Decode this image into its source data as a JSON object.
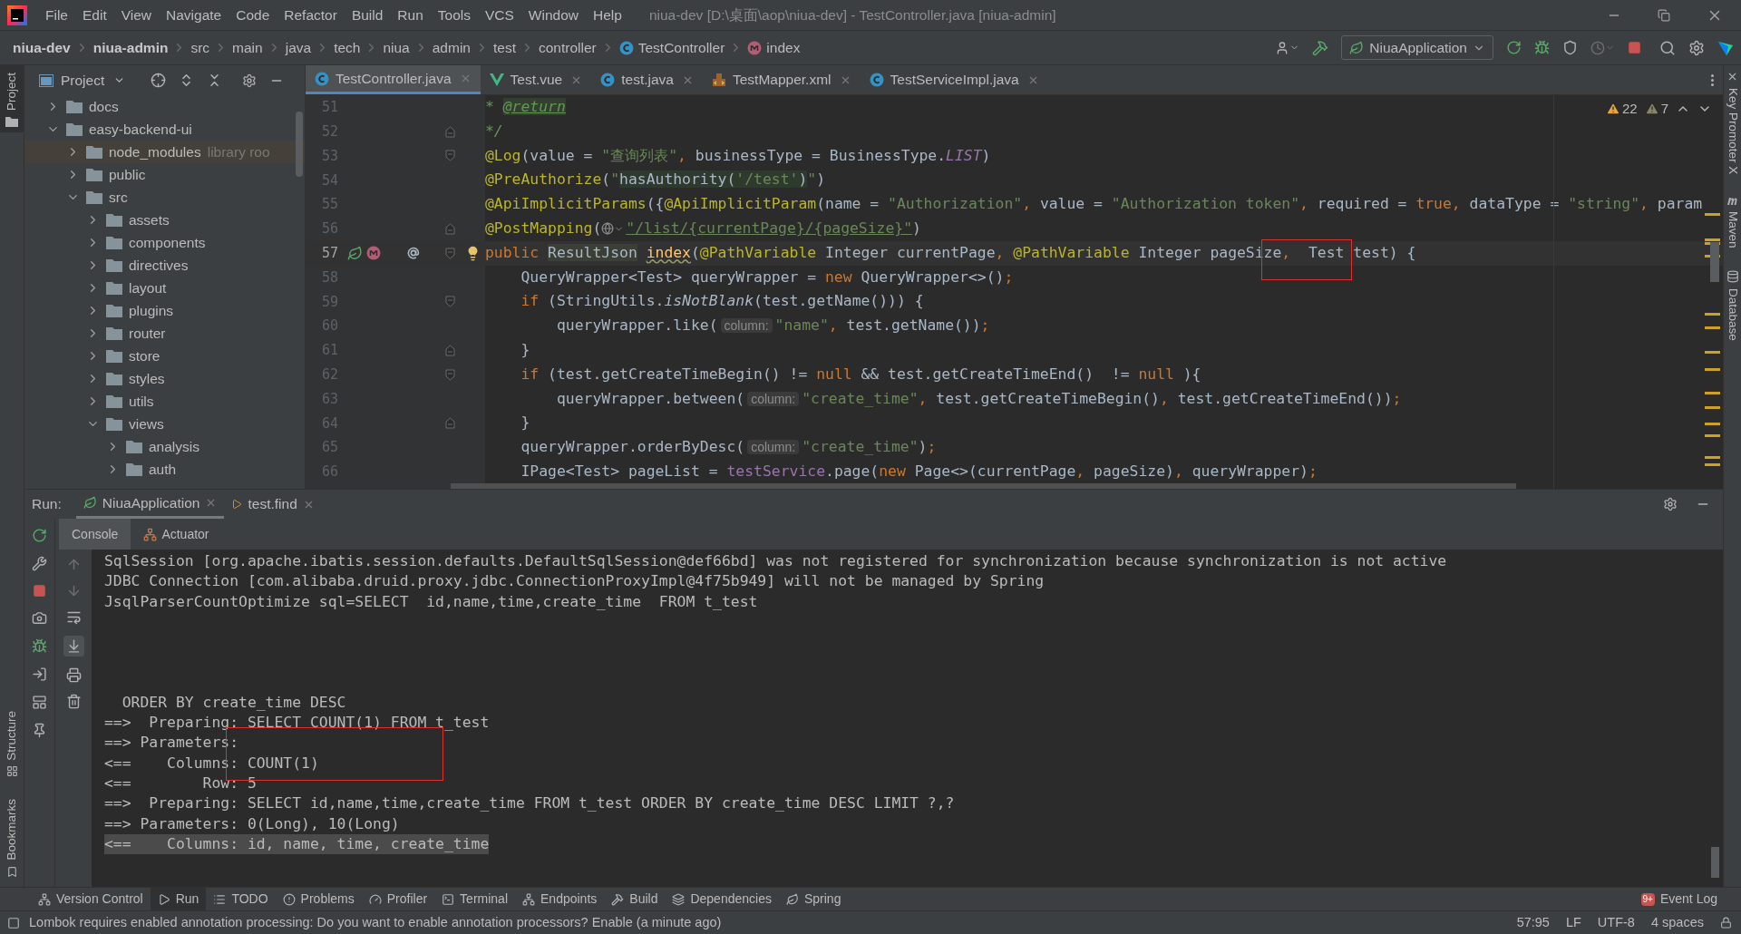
{
  "menu": [
    "File",
    "Edit",
    "View",
    "Navigate",
    "Code",
    "Refactor",
    "Build",
    "Run",
    "Tools",
    "VCS",
    "Window",
    "Help"
  ],
  "window": {
    "title": "niua-dev [D:\\桌面\\aop\\niua-dev] - TestController.java [niua-admin]"
  },
  "breadcrumb": [
    {
      "kind": "module",
      "label": "niua-dev"
    },
    {
      "kind": "module",
      "label": "niua-admin"
    },
    {
      "kind": "folder",
      "label": "src"
    },
    {
      "kind": "folder",
      "label": "main"
    },
    {
      "kind": "folder",
      "label": "java"
    },
    {
      "kind": "folder",
      "label": "tech"
    },
    {
      "kind": "folder",
      "label": "niua"
    },
    {
      "kind": "folder",
      "label": "admin"
    },
    {
      "kind": "folder",
      "label": "test"
    },
    {
      "kind": "folder",
      "label": "controller"
    },
    {
      "kind": "class",
      "label": "TestController"
    },
    {
      "kind": "method",
      "label": "index"
    }
  ],
  "run_config": {
    "label": "NiuaApplication"
  },
  "project_panel": {
    "title": "Project",
    "tree": [
      {
        "name": "docs",
        "expanded": false
      },
      {
        "name": "easy-backend-ui",
        "expanded": true,
        "children": [
          {
            "name": "node_modules",
            "note": "library roo",
            "expanded": false
          },
          {
            "name": "public",
            "expanded": false
          },
          {
            "name": "src",
            "expanded": true,
            "children": [
              {
                "name": "assets",
                "expanded": false
              },
              {
                "name": "components",
                "expanded": false
              },
              {
                "name": "directives",
                "expanded": false
              },
              {
                "name": "layout",
                "expanded": false
              },
              {
                "name": "plugins",
                "expanded": false
              },
              {
                "name": "router",
                "expanded": false
              },
              {
                "name": "store",
                "expanded": false
              },
              {
                "name": "styles",
                "expanded": false
              },
              {
                "name": "utils",
                "expanded": false
              },
              {
                "name": "views",
                "expanded": true,
                "children": [
                  {
                    "name": "analysis",
                    "expanded": false
                  },
                  {
                    "name": "auth",
                    "expanded": false
                  }
                ]
              }
            ]
          }
        ]
      }
    ]
  },
  "editor_tabs": [
    {
      "kind": "class",
      "label": "TestController.java",
      "selected": true
    },
    {
      "kind": "vue",
      "label": "Test.vue",
      "selected": false
    },
    {
      "kind": "class",
      "label": "test.java",
      "selected": false
    },
    {
      "kind": "xml",
      "label": "TestMapper.xml",
      "selected": false
    },
    {
      "kind": "class",
      "label": "TestServiceImpl.java",
      "selected": false
    }
  ],
  "inspections": {
    "warnings": "22",
    "weak_warnings": "7"
  },
  "code_lines": [
    {
      "num": "51",
      "current": false,
      "fold_start": false,
      "fold_end": false,
      "tokens": [
        {
          "kind": "doc",
          "text": "* "
        },
        {
          "kind": "doctag",
          "text": "@return"
        }
      ]
    },
    {
      "num": "52",
      "current": false,
      "fold_start": false,
      "fold_end": true,
      "tokens": [
        {
          "kind": "doc",
          "text": "*/"
        }
      ]
    },
    {
      "num": "53",
      "current": false,
      "fold_start": true,
      "fold_end": false,
      "tokens": [
        {
          "kind": "ann",
          "text": "@Log"
        },
        {
          "kind": "plain",
          "text": "(value = "
        },
        {
          "kind": "str",
          "text": "\"查询列表\""
        },
        {
          "kind": "kw",
          "text": ", "
        },
        {
          "kind": "plain",
          "text": "businessType = BusinessType."
        },
        {
          "kind": "static",
          "text": "LIST"
        },
        {
          "kind": "plain",
          "text": ")"
        }
      ]
    },
    {
      "num": "54",
      "current": false,
      "fold_start": false,
      "fold_end": false,
      "tokens": [
        {
          "kind": "ann",
          "text": "@PreAuthorize"
        },
        {
          "kind": "plain",
          "text": "("
        },
        {
          "kind": "str",
          "text": "\""
        },
        {
          "kind": "inject",
          "text": "hasAuthority("
        },
        {
          "kind": "injectstr",
          "text": "'/test'"
        },
        {
          "kind": "inject",
          "text": ")"
        },
        {
          "kind": "str",
          "text": "\""
        },
        {
          "kind": "plain",
          "text": ")"
        }
      ]
    },
    {
      "num": "55",
      "current": false,
      "fold_start": false,
      "fold_end": false,
      "tokens": [
        {
          "kind": "ann",
          "text": "@ApiImplicitParams"
        },
        {
          "kind": "plain",
          "text": "({"
        },
        {
          "kind": "ann",
          "text": "@ApiImplicitParam"
        },
        {
          "kind": "plain",
          "text": "(name = "
        },
        {
          "kind": "str",
          "text": "\"Authorization\""
        },
        {
          "kind": "kw",
          "text": ", "
        },
        {
          "kind": "plain",
          "text": "value = "
        },
        {
          "kind": "str",
          "text": "\"Authorization token\""
        },
        {
          "kind": "kw",
          "text": ", "
        },
        {
          "kind": "plain",
          "text": "required = "
        },
        {
          "kind": "kw",
          "text": "true, "
        },
        {
          "kind": "plain",
          "text": "dataType = "
        },
        {
          "kind": "str",
          "text": "\"string\""
        },
        {
          "kind": "kw",
          "text": ", "
        },
        {
          "kind": "plain",
          "text": "param"
        }
      ]
    },
    {
      "num": "56",
      "current": false,
      "fold_start": false,
      "fold_end": true,
      "tokens": [
        {
          "kind": "ann",
          "text": "@PostMapping"
        },
        {
          "kind": "plain",
          "text": "("
        },
        {
          "kind": "url",
          "text": "\"/list/{currentPage}/{pageSize}\""
        },
        {
          "kind": "plain",
          "text": ")"
        }
      ]
    },
    {
      "num": "57",
      "current": true,
      "fold_start": true,
      "fold_end": false,
      "tokens": [
        {
          "kind": "kw",
          "text": "public "
        },
        {
          "kind": "typebg",
          "text": "ResultJson"
        },
        {
          "kind": "decl",
          "text": " index"
        },
        {
          "kind": "plain",
          "text": "("
        },
        {
          "kind": "ann",
          "text": "@PathVariable"
        },
        {
          "kind": "plain",
          "text": " Integer currentPage"
        },
        {
          "kind": "kw",
          "text": ", "
        },
        {
          "kind": "ann",
          "text": "@PathVariable"
        },
        {
          "kind": "plain",
          "text": " Integer pageSize"
        },
        {
          "kind": "kw",
          "text": ", "
        },
        {
          "kind": "plain",
          "text": " Test test) {"
        }
      ]
    },
    {
      "num": "58",
      "current": false,
      "fold_start": false,
      "fold_end": false,
      "tokens": [
        {
          "kind": "plain",
          "text": "    QueryWrapper<Test> queryWrapper = "
        },
        {
          "kind": "kw",
          "text": "new "
        },
        {
          "kind": "plain",
          "text": "QueryWrapper<>()"
        },
        {
          "kind": "kw",
          "text": ";"
        }
      ]
    },
    {
      "num": "59",
      "current": false,
      "fold_start": true,
      "fold_end": false,
      "tokens": [
        {
          "kind": "kw",
          "text": "    if "
        },
        {
          "kind": "plain",
          "text": "(StringUtils."
        },
        {
          "kind": "italic",
          "text": "isNotBlank"
        },
        {
          "kind": "plain",
          "text": "(test.getName())) {"
        }
      ]
    },
    {
      "num": "60",
      "current": false,
      "fold_start": false,
      "fold_end": false,
      "tokens": [
        {
          "kind": "plain",
          "text": "        queryWrapper.like("
        },
        {
          "kind": "hint",
          "text": "column:"
        },
        {
          "kind": "str",
          "text": "\"name\""
        },
        {
          "kind": "kw",
          "text": ", "
        },
        {
          "kind": "plain",
          "text": "test.getName())"
        },
        {
          "kind": "kw",
          "text": ";"
        }
      ]
    },
    {
      "num": "61",
      "current": false,
      "fold_start": false,
      "fold_end": true,
      "tokens": [
        {
          "kind": "plain",
          "text": "    }"
        }
      ]
    },
    {
      "num": "62",
      "current": false,
      "fold_start": true,
      "fold_end": false,
      "tokens": [
        {
          "kind": "kw",
          "text": "    if "
        },
        {
          "kind": "plain",
          "text": "(test.getCreateTimeBegin() != "
        },
        {
          "kind": "kw",
          "text": "null "
        },
        {
          "kind": "plain",
          "text": "&& test.getCreateTimeEnd()  != "
        },
        {
          "kind": "kw",
          "text": "null "
        },
        {
          "kind": "plain",
          "text": "){"
        }
      ]
    },
    {
      "num": "63",
      "current": false,
      "fold_start": false,
      "fold_end": false,
      "tokens": [
        {
          "kind": "plain",
          "text": "        queryWrapper.between("
        },
        {
          "kind": "hint",
          "text": "column:"
        },
        {
          "kind": "str",
          "text": "\"create_time\""
        },
        {
          "kind": "kw",
          "text": ", "
        },
        {
          "kind": "plain",
          "text": "test.getCreateTimeBegin()"
        },
        {
          "kind": "kw",
          "text": ", "
        },
        {
          "kind": "plain",
          "text": "test.getCreateTimeEnd())"
        },
        {
          "kind": "kw",
          "text": ";"
        }
      ]
    },
    {
      "num": "64",
      "current": false,
      "fold_start": false,
      "fold_end": true,
      "tokens": [
        {
          "kind": "plain",
          "text": "    }"
        }
      ]
    },
    {
      "num": "65",
      "current": false,
      "fold_start": false,
      "fold_end": false,
      "tokens": [
        {
          "kind": "plain",
          "text": "    queryWrapper.orderByDesc("
        },
        {
          "kind": "hint",
          "text": "column:"
        },
        {
          "kind": "str",
          "text": "\"create_time\""
        },
        {
          "kind": "plain",
          "text": ")"
        },
        {
          "kind": "kw",
          "text": ";"
        }
      ]
    },
    {
      "num": "66",
      "current": false,
      "fold_start": false,
      "fold_end": false,
      "tokens": [
        {
          "kind": "plain",
          "text": "    IPage<Test> pageList = "
        },
        {
          "kind": "field",
          "text": "testService"
        },
        {
          "kind": "plain",
          "text": ".page("
        },
        {
          "kind": "kw",
          "text": "new "
        },
        {
          "kind": "plain",
          "text": "Page<>(currentPage"
        },
        {
          "kind": "kw",
          "text": ", "
        },
        {
          "kind": "plain",
          "text": "pageSize)"
        },
        {
          "kind": "kw",
          "text": ", "
        },
        {
          "kind": "plain",
          "text": "queryWrapper)"
        },
        {
          "kind": "kw",
          "text": ";"
        }
      ]
    }
  ],
  "run_panel": {
    "label": "Run:",
    "tabs": [
      {
        "kind": "app",
        "label": "NiuaApplication",
        "selected": true
      },
      {
        "kind": "query",
        "label": "test.find",
        "selected": false
      }
    ],
    "subtabs": [
      {
        "kind": "console",
        "label": "Console",
        "selected": true
      },
      {
        "kind": "actuator",
        "label": "Actuator",
        "selected": false
      }
    ],
    "console_lines": [
      {
        "kind": "text",
        "text": "SqlSession [org.apache.ibatis.session.defaults.DefaultSqlSession@def66bd] was not registered for synchronization because synchronization is not active"
      },
      {
        "kind": "text",
        "text": "JDBC Connection [com.alibaba.druid.proxy.jdbc.ConnectionProxyImpl@4f75b949] will not be managed by Spring"
      },
      {
        "kind": "text",
        "text": "JsqlParserCountOptimize sql=SELECT  id,name,time,create_time  FROM t_test"
      },
      {
        "kind": "after_gap",
        "text": "  ORDER BY create_time DESC"
      },
      {
        "kind": "text",
        "text": "==>  Preparing: SELECT COUNT(1) FROM t_test"
      },
      {
        "kind": "text",
        "text": "==> Parameters: "
      },
      {
        "kind": "text",
        "text": "<==    Columns: COUNT(1)"
      },
      {
        "kind": "text",
        "text": "<==        Row: 5"
      },
      {
        "kind": "text",
        "text": "==>  Preparing: SELECT id,name,time,create_time FROM t_test ORDER BY create_time DESC LIMIT ?,?"
      },
      {
        "kind": "text",
        "text": "==> Parameters: 0(Long), 10(Long)"
      },
      {
        "kind": "selected",
        "text": "<==    Columns: id, name, time, create_time"
      }
    ]
  },
  "left_strip": [
    {
      "kind": "project",
      "label": "Project"
    },
    {
      "kind": "structure",
      "label": "Structure"
    },
    {
      "kind": "bookmarks",
      "label": "Bookmarks"
    }
  ],
  "right_strip": [
    {
      "kind": "promoter",
      "label": "Key Promoter X"
    },
    {
      "kind": "maven",
      "label": "Maven"
    },
    {
      "kind": "database",
      "label": "Database"
    }
  ],
  "bottom_tools": [
    {
      "kind": "vcs",
      "label": "Version Control",
      "selected": false
    },
    {
      "kind": "run",
      "label": "Run",
      "selected": true
    },
    {
      "kind": "todo",
      "label": "TODO",
      "selected": false
    },
    {
      "kind": "problems",
      "label": "Problems",
      "selected": false
    },
    {
      "kind": "profiler",
      "label": "Profiler",
      "selected": false
    },
    {
      "kind": "terminal",
      "label": "Terminal",
      "selected": false
    },
    {
      "kind": "endpoints",
      "label": "Endpoints",
      "selected": false
    },
    {
      "kind": "build",
      "label": "Build",
      "selected": false
    },
    {
      "kind": "dependencies",
      "label": "Dependencies",
      "selected": false
    },
    {
      "kind": "spring",
      "label": "Spring",
      "selected": false
    }
  ],
  "event_log": {
    "badge": "9+",
    "label": "Event Log"
  },
  "status_bar": {
    "message": "Lombok requires enabled annotation processing: Do you want to enable annotation processors? Enable (a minute ago)",
    "items": [
      "57:95",
      "LF",
      "UTF-8",
      "4 spaces"
    ]
  }
}
